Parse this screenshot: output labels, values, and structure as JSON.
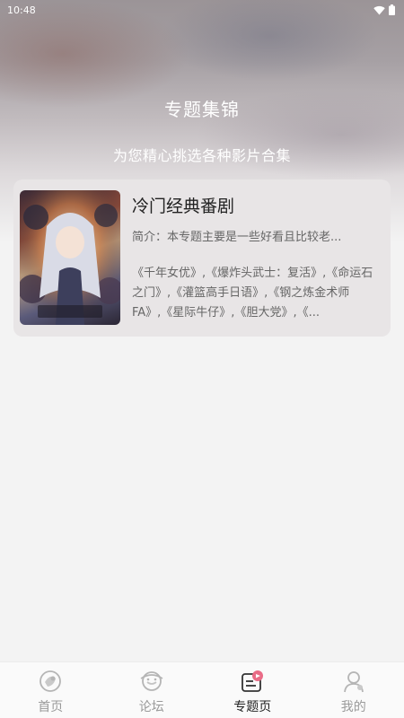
{
  "status_bar": {
    "time": "10:48"
  },
  "header": {
    "title": "专题集锦",
    "subtitle": "为您精心挑选各种影片合集"
  },
  "topics": [
    {
      "title": "冷门经典番剧",
      "intro": "简介：本专题主要是一些好看且比较老...",
      "list": "《千年女优》,《爆炸头武士：复活》,《命运石之门》,《灌篮高手日语》,《钢之炼金术师FA》,《星际牛仔》,《胆大党》,《..."
    }
  ],
  "bottom_nav": [
    {
      "label": "首页",
      "icon": "home-icon"
    },
    {
      "label": "论坛",
      "icon": "forum-icon"
    },
    {
      "label": "专题页",
      "icon": "topics-icon",
      "active": true
    },
    {
      "label": "我的",
      "icon": "profile-icon"
    }
  ],
  "colors": {
    "accent": "#e96b86",
    "nav_inactive": "#9a9a9a",
    "nav_active": "#222222"
  }
}
